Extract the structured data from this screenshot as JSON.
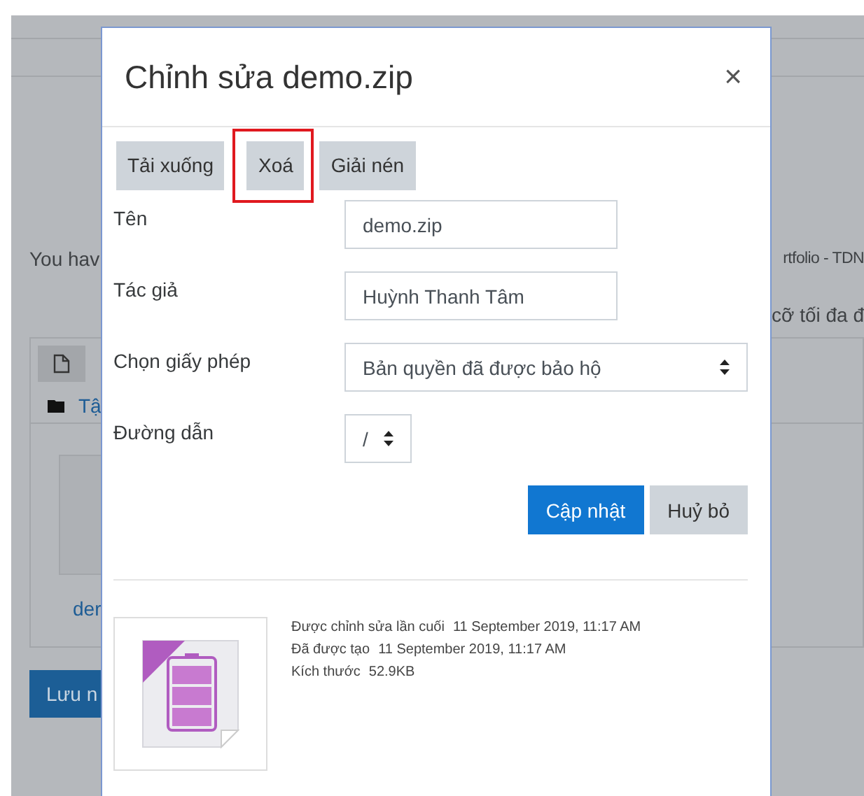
{
  "background": {
    "intro_left": "You hav",
    "intro_right": "rtfolio - TDN",
    "size_note": "cỡ tối đa đ",
    "folder_link": "Tậ",
    "file_name": "der",
    "save_button": "Lưu n"
  },
  "dialog": {
    "title": "Chỉnh sửa demo.zip",
    "close": "×",
    "actions": [
      {
        "label": "Tải xuống",
        "highlighted": false
      },
      {
        "label": "Xoá",
        "highlighted": true
      },
      {
        "label": "Giải nén",
        "highlighted": false
      }
    ],
    "fields": [
      {
        "kind": "text",
        "label": "Tên",
        "value": "demo.zip"
      },
      {
        "kind": "text",
        "label": "Tác giả",
        "value": "Huỳnh Thanh Tâm"
      },
      {
        "kind": "select",
        "label": "Chọn giấy phép",
        "value": "Bản quyền đã được bảo hộ"
      },
      {
        "kind": "small-select",
        "label": "Đường dẫn",
        "value": "/"
      }
    ],
    "buttons": [
      {
        "label": "Cập nhật",
        "kind": "primary"
      },
      {
        "label": "Huỷ bỏ",
        "kind": "secondary"
      }
    ],
    "info": [
      {
        "label": "Được chỉnh sửa lần cuối",
        "value": "11 September 2019, 11:17 AM"
      },
      {
        "label": "Đã được tạo",
        "value": "11 September 2019, 11:17 AM"
      },
      {
        "label": "Kích thước",
        "value": "52.9KB"
      }
    ]
  }
}
